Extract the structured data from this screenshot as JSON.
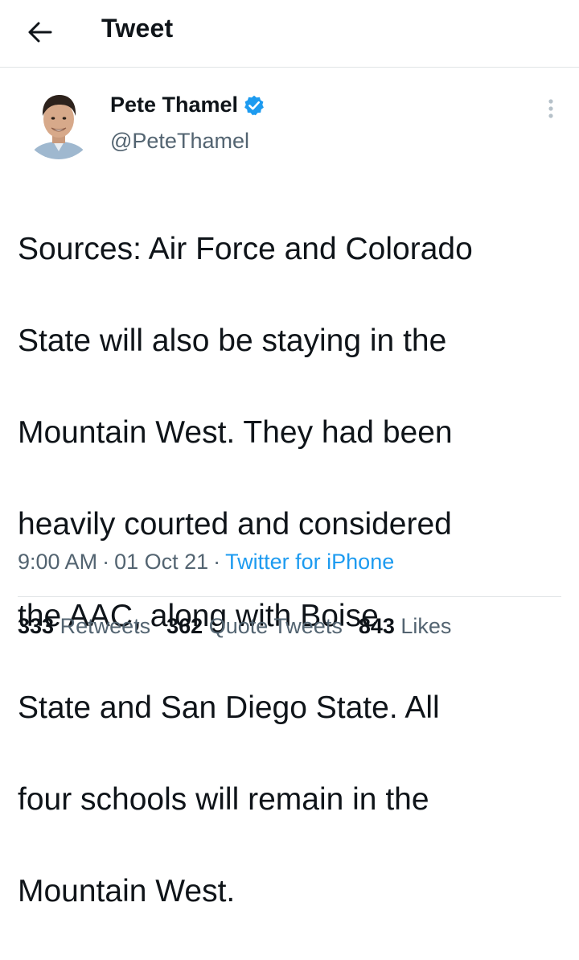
{
  "header": {
    "title": "Tweet",
    "back_icon": "arrow-left-icon"
  },
  "author": {
    "name": "Pete Thamel",
    "handle": "@PeteThamel",
    "verified_icon": "verified-badge-icon",
    "verified_color": "#1d9bf0"
  },
  "tweet": {
    "lines": [
      "Sources: Air Force and Colorado",
      "State will also be staying in the",
      "Mountain West. They had been",
      "heavily courted and considered",
      "the AAC, along with Boise",
      "State and San Diego State. All",
      "four schools will remain in the",
      "Mountain West."
    ],
    "time": "9:00 AM",
    "date": "01 Oct 21",
    "source": "Twitter for iPhone",
    "separator": "·"
  },
  "stats": {
    "retweets_count": "333",
    "retweets_label": "Retweets",
    "quotes_count": "362",
    "quotes_label": "Quote Tweets",
    "likes_count": "843",
    "likes_label": "Likes"
  },
  "colors": {
    "accent": "#1d9bf0",
    "text": "#0f1419",
    "secondary": "#536471",
    "border": "#e1e4e6"
  }
}
